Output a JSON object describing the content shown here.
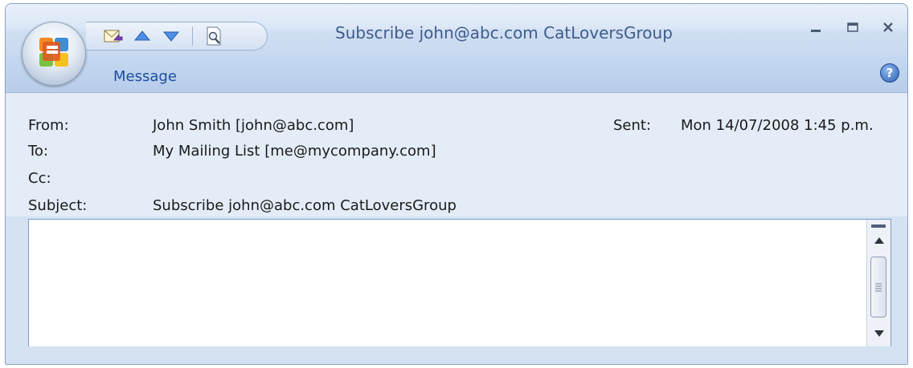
{
  "window": {
    "title": "Subscribe john@abc.com CatLoversGroup",
    "controls": {
      "minimize_icon": "minimize-icon",
      "maximize_icon": "maximize-icon",
      "close_icon": "close-icon"
    }
  },
  "office_button": {
    "icon": "office-logo-icon"
  },
  "quick_access": {
    "items": [
      "reply-icon",
      "previous-item-icon",
      "next-item-icon",
      "print-preview-icon"
    ]
  },
  "ribbon": {
    "tabs": [
      {
        "label": "Message"
      }
    ],
    "help_icon": "help-icon",
    "help_glyph": "?"
  },
  "header": {
    "from_label": "From:",
    "from_value": "John Smith [john@abc.com]",
    "sent_label": "Sent:",
    "sent_value": "Mon 14/07/2008 1:45 p.m.",
    "to_label": "To:",
    "to_value": "My Mailing List [me@mycompany.com]",
    "cc_label": "Cc:",
    "cc_value": "",
    "subject_label": "Subject:",
    "subject_value": "Subscribe john@abc.com CatLoversGroup"
  },
  "message_body": {
    "text": ""
  },
  "colors": {
    "frame": "#d5e2f2",
    "ribbon": "#bfd3ed",
    "tab_text": "#1d4fa0",
    "title_text": "#3e5c8a",
    "body_border": "#7c9cc8"
  }
}
